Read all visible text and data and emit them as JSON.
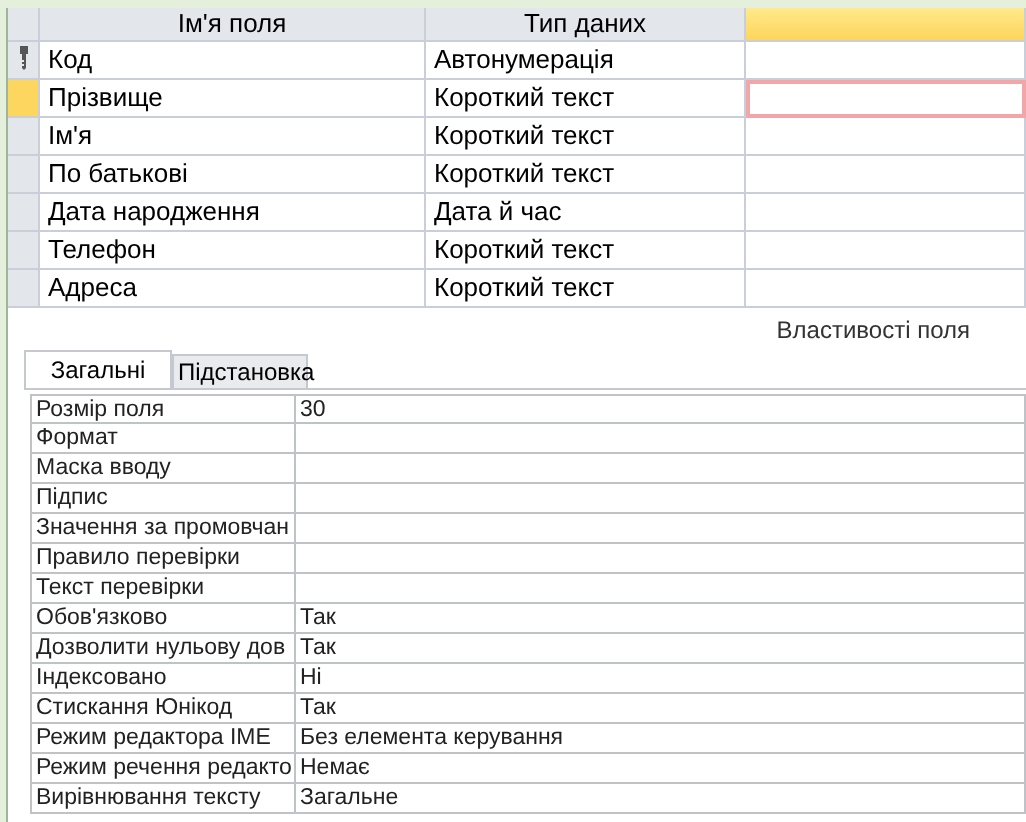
{
  "columns": [
    {
      "label": "Ім'я поля",
      "selected": false
    },
    {
      "label": "Тип даних",
      "selected": false
    },
    {
      "selected": true
    }
  ],
  "rows": [
    {
      "name": "Код",
      "type": "Автонумерація",
      "primary_key": true,
      "selected": false
    },
    {
      "name": "Прізвище",
      "type": "Короткий текст",
      "primary_key": false,
      "selected": true
    },
    {
      "name": "Ім'я",
      "type": "Короткий текст",
      "primary_key": false,
      "selected": false
    },
    {
      "name": "По батькові",
      "type": "Короткий текст",
      "primary_key": false,
      "selected": false
    },
    {
      "name": "Дата народження",
      "type": "Дата й час",
      "primary_key": false,
      "selected": false
    },
    {
      "name": "Телефон",
      "type": "Короткий текст",
      "primary_key": false,
      "selected": false
    },
    {
      "name": "Адреса",
      "type": "Короткий текст",
      "primary_key": false,
      "selected": false
    }
  ],
  "properties_caption": "Властивості поля",
  "tabs": [
    {
      "label": "Загальні",
      "selected": true
    },
    {
      "label": "Підстановка",
      "selected": false
    }
  ],
  "properties": [
    {
      "name": "Розмір поля",
      "value": "30"
    },
    {
      "name": "Формат"
    },
    {
      "name": "Маска вводу"
    },
    {
      "name": "Підпис"
    },
    {
      "name": "Значення за промовчан"
    },
    {
      "name": "Правило перевірки"
    },
    {
      "name": "Текст перевірки"
    },
    {
      "name": "Обов'язково",
      "value": "Так"
    },
    {
      "name": "Дозволити нульову дов",
      "value": "Так"
    },
    {
      "name": "Індексовано",
      "value": "Ні"
    },
    {
      "name": "Стискання Юнікод",
      "value": "Так"
    },
    {
      "name": "Режим редактора IME",
      "value": "Без елемента керування"
    },
    {
      "name": "Режим речення редакто",
      "value": "Немає"
    },
    {
      "name": "Вирівнювання тексту",
      "value": "Загальне"
    }
  ]
}
